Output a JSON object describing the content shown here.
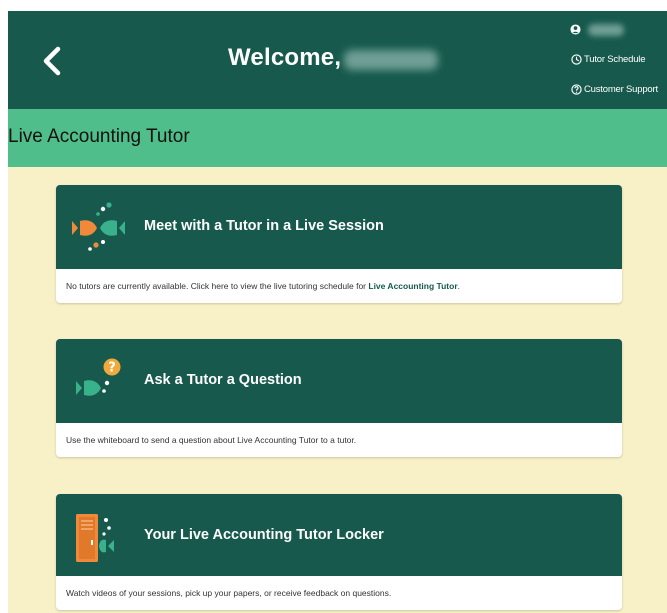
{
  "header": {
    "welcome": "Welcome,",
    "links": {
      "schedule": "Tutor Schedule",
      "support": "Customer Support"
    }
  },
  "page": {
    "title": "Live Accounting Tutor"
  },
  "cards": [
    {
      "title": "Meet with a Tutor in a Live Session",
      "desc_before": "No tutors are currently available. Click here to view the live tutoring schedule for ",
      "desc_strong": "Live Accounting Tutor",
      "desc_after": "."
    },
    {
      "title": "Ask a Tutor a Question",
      "desc": "Use the whiteboard to send a question about Live Accounting Tutor to a tutor."
    },
    {
      "title": "Your Live Accounting Tutor Locker",
      "desc": "Watch videos of your sessions, pick up your papers, or receive feedback on questions."
    }
  ],
  "colors": {
    "header_bg": "#175a4d",
    "title_band": "#4fbe8a",
    "content_bg": "#f8f0c6",
    "accent_orange": "#f08a3a",
    "accent_green": "#39b18b"
  },
  "icons": {
    "back": "chevron-left-icon",
    "user": "user-icon",
    "schedule": "clock-icon",
    "support": "question-circle-icon",
    "live_session": "fish-session-icon",
    "question": "fish-question-icon",
    "locker": "locker-icon"
  }
}
